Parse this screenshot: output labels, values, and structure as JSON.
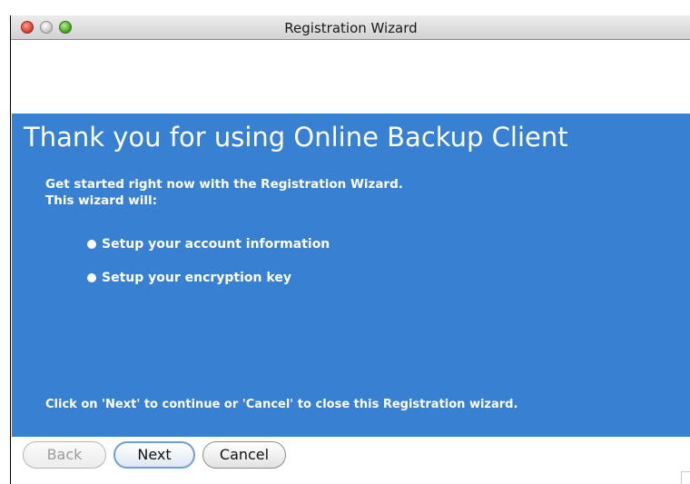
{
  "window": {
    "title": "Registration Wizard"
  },
  "panel": {
    "heading": "Thank you for using Online Backup Client",
    "intro_line1": "Get started right now with the Registration Wizard.",
    "intro_line2": "This wizard will:",
    "bullets": [
      "Setup your account information",
      "Setup your encryption key"
    ],
    "footer": "Click on 'Next' to continue or 'Cancel' to close this Registration wizard.",
    "background_color": "#3880d2"
  },
  "buttons": {
    "back": "Back",
    "next": "Next",
    "cancel": "Cancel"
  }
}
